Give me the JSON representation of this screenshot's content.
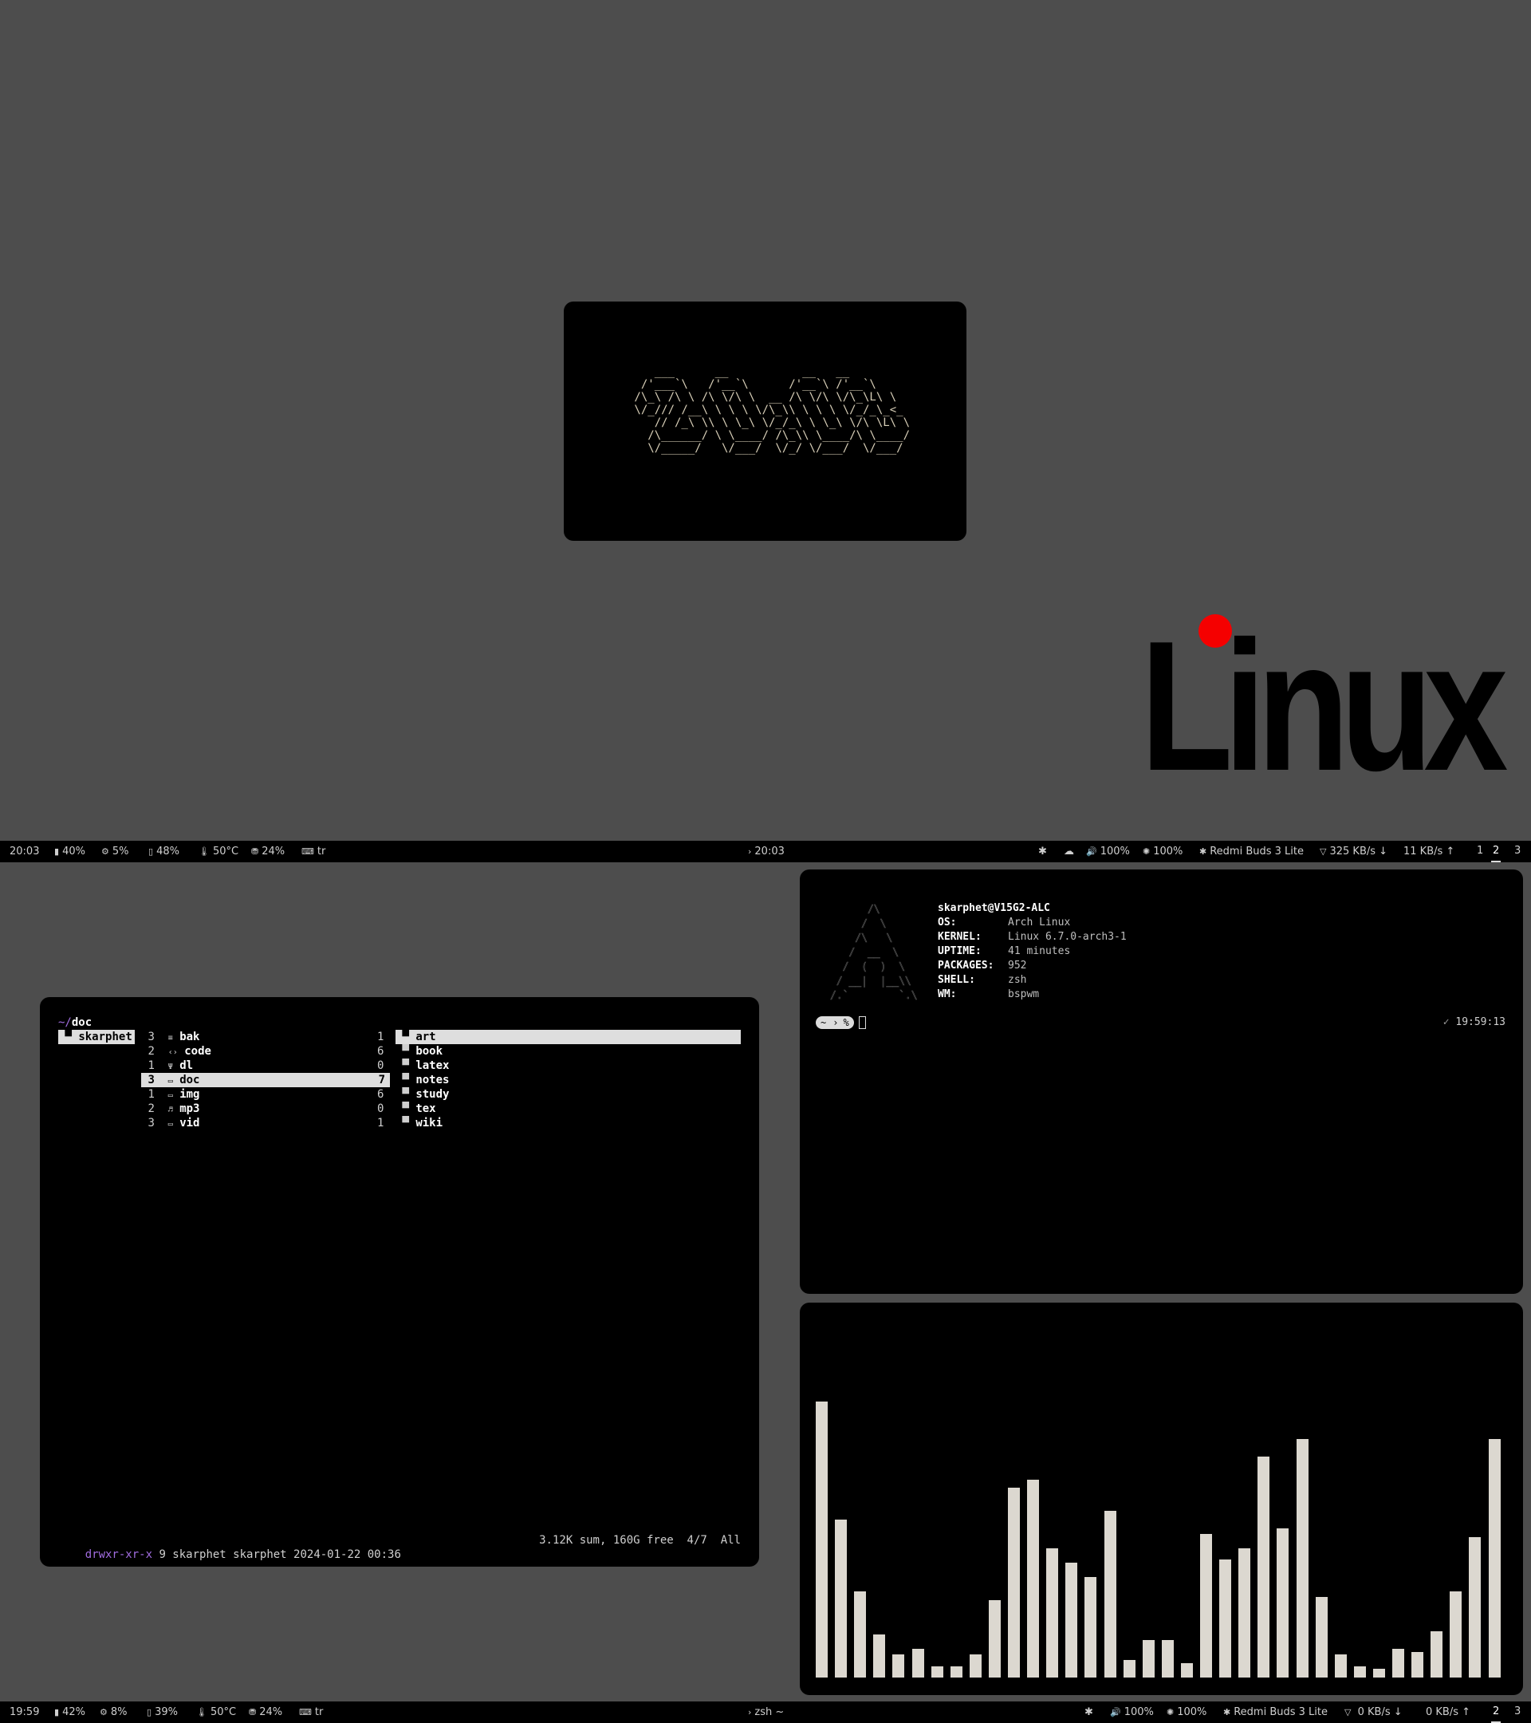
{
  "top_bar": {
    "time": "20:03",
    "battery": "40%",
    "cpu": "5%",
    "memory": "48%",
    "temperature": "50°C",
    "disk": "24%",
    "keyboard": "tr",
    "center_title": "20:03",
    "volume": "100%",
    "brightness": "100%",
    "bluetooth_device": "Redmi Buds 3 Lite",
    "net_down": "325 KB/s",
    "net_up": "11 KB/s",
    "workspaces": [
      "1",
      "2",
      "3"
    ],
    "active_workspace": "2"
  },
  "bottom_bar": {
    "time": "19:59",
    "battery": "42%",
    "cpu": "8%",
    "memory": "39%",
    "temperature": "50°C",
    "disk": "24%",
    "keyboard": "tr",
    "center_title": "zsh ~",
    "volume": "100%",
    "brightness": "100%",
    "bluetooth_device": "Redmi Buds 3 Lite",
    "net_down": "0 KB/s",
    "net_up": "0 KB/s",
    "workspaces": [
      "2",
      "3"
    ],
    "active_workspace": "2"
  },
  "splash": {
    "ascii_art": "    ___      __           __   __\n  /'___`\\   /'__`\\      /'__`\\ /'__`\\\n /\\_\\ /\\ \\ /\\ \\/\\ \\  __ /\\ \\/\\ \\/\\_\\L\\ \\\n \\/_/// /__\\ \\ \\ \\ \\/\\_\\\\ \\ \\ \\ \\/_/_\\_<_\n    // /_\\ \\\\ \\ \\_\\ \\/_/_\\ \\ \\_\\ \\/\\ \\L\\ \\\n   /\\______/ \\ \\____/ /\\_\\\\ \\____/\\ \\____/\n   \\/_____/   \\/___/  \\/_/ \\/___/  \\/___/"
  },
  "wallpaper": {
    "logo_text": "Linux",
    "dot_color": "#f50000"
  },
  "file_manager": {
    "path_prefix": "~/",
    "path_dir": "doc",
    "parent_column": [
      "skarphet"
    ],
    "current_column": [
      {
        "count": "3",
        "icon": "≡",
        "name": "bak"
      },
      {
        "count": "2",
        "icon": "‹›",
        "name": "code"
      },
      {
        "count": "1",
        "icon": "Ψ",
        "name": "dl"
      },
      {
        "count": "3",
        "icon": "▭",
        "name": "doc"
      },
      {
        "count": "1",
        "icon": "▭",
        "name": "img"
      },
      {
        "count": "2",
        "icon": "♬",
        "name": "mp3"
      },
      {
        "count": "3",
        "icon": "▭",
        "name": "vid"
      }
    ],
    "preview_column": [
      {
        "count": "1",
        "name": "art"
      },
      {
        "count": "6",
        "name": "book"
      },
      {
        "count": "0",
        "name": "latex"
      },
      {
        "count": "7",
        "name": "notes"
      },
      {
        "count": "6",
        "name": "study"
      },
      {
        "count": "0",
        "name": "tex"
      },
      {
        "count": "1",
        "name": "wiki"
      }
    ],
    "status_perms": "drwxr-xr-x",
    "status_info": "9 skarphet skarphet 2024-01-22 00:36",
    "status_right": "3.12K sum, 160G free  4/7  All"
  },
  "terminal": {
    "user_host": "skarphet@V15G2-ALC",
    "info": [
      {
        "label": "OS:",
        "value": "Arch Linux"
      },
      {
        "label": "KERNEL:",
        "value": "Linux 6.7.0-arch3-1"
      },
      {
        "label": "UPTIME:",
        "value": "41 minutes"
      },
      {
        "label": "PACKAGES:",
        "value": "952"
      },
      {
        "label": "SHELL:",
        "value": "zsh"
      },
      {
        "label": "WM:",
        "value": "bspwm"
      }
    ],
    "ascii_logo": "      /\\\n     /  \\\n    /\\   \\\n   /  __  \\\n  /  (  )  \\\n / __|  |__\\\\\n/.`        `.\\",
    "prompt_dir": "~",
    "prompt_char": "%",
    "time": "19:59:13",
    "check": "✓"
  },
  "visualizer": {
    "levels": [
      0.96,
      0.55,
      0.3,
      0.15,
      0.08,
      0.1,
      0.04,
      0.04,
      0.08,
      0.27,
      0.66,
      0.69,
      0.45,
      0.4,
      0.35,
      0.58,
      0.06,
      0.13,
      0.13,
      0.05,
      0.5,
      0.41,
      0.45,
      0.77,
      0.52,
      0.83,
      0.28,
      0.08,
      0.04,
      0.03,
      0.1,
      0.09,
      0.16,
      0.3,
      0.49,
      0.83
    ],
    "color": "#dcd8d0"
  }
}
